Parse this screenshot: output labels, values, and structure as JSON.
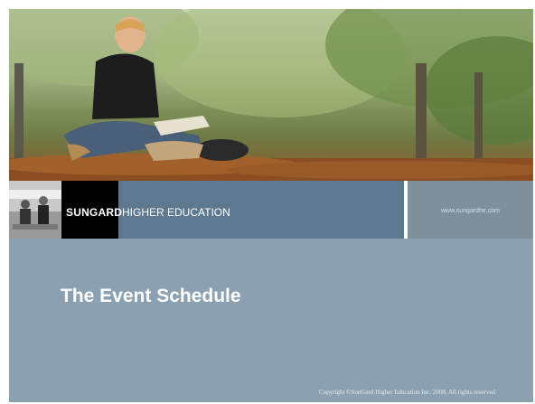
{
  "header": {
    "brand_name": "SUNGARD",
    "brand_subtitle": "HIGHER EDUCATION",
    "website": "www.sungardhe.com"
  },
  "slide": {
    "title": "The Event Schedule",
    "copyright": "Copyright ©SunGard Higher Education Inc.  2008.  All rights reserved"
  },
  "colors": {
    "slide_background": "#8ba0b1",
    "band_blue": "#5e7890",
    "band_gray": "#7f8f9c",
    "logo_black": "#000000"
  }
}
